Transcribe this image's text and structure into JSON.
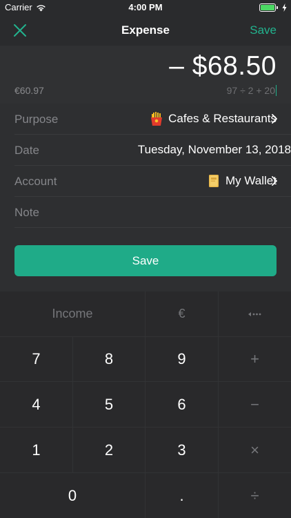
{
  "status_bar": {
    "carrier": "Carrier",
    "time": "4:00 PM"
  },
  "nav": {
    "title": "Expense",
    "save_label": "Save"
  },
  "amount": {
    "display": "– $68.50",
    "converted": "€60.97",
    "expression": "97 ÷ 2 + 20"
  },
  "form": {
    "purpose": {
      "label": "Purpose",
      "value": "Cafes & Restaurants",
      "icon": "fries-icon"
    },
    "date": {
      "label": "Date",
      "value": "Tuesday, November 13, 2018"
    },
    "account": {
      "label": "Account",
      "value": "My Wallet",
      "icon": "wallet-icon"
    },
    "note": {
      "label": "Note",
      "value": ""
    },
    "save_label": "Save"
  },
  "keypad": {
    "income_label": "Income",
    "currency_label": "€",
    "keys": {
      "k7": "7",
      "k8": "8",
      "k9": "9",
      "plus": "+",
      "k4": "4",
      "k5": "5",
      "k6": "6",
      "minus": "−",
      "k1": "1",
      "k2": "2",
      "k3": "3",
      "times": "×",
      "k0": "0",
      "dot": ".",
      "divide": "÷"
    }
  },
  "colors": {
    "accent": "#22b38e",
    "save_button": "#1fab88",
    "background": "#2b2c2e",
    "keypad_background": "#29292b",
    "battery": "#4cd964"
  }
}
